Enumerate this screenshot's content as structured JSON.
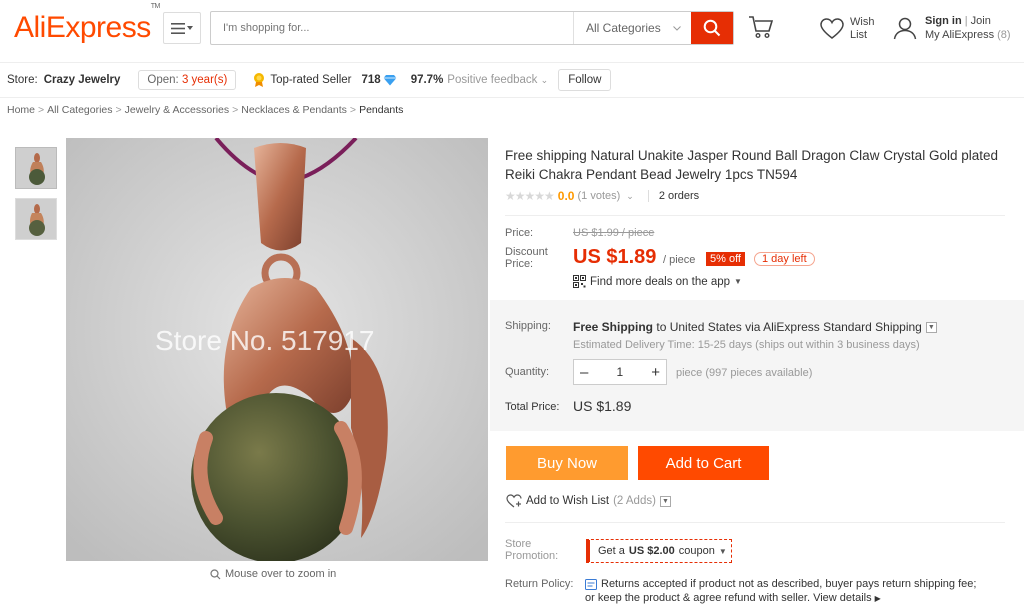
{
  "header": {
    "logo": "AliExpress",
    "logo_tm": "TM",
    "search_placeholder": "I'm shopping for...",
    "category": "All Categories",
    "wish_line1": "Wish",
    "wish_line2": "List",
    "signin": "Sign in",
    "join": "Join",
    "my_account": "My AliExpress",
    "account_count": "(8)"
  },
  "store": {
    "label": "Store:",
    "name": "Crazy Jewelry",
    "open_prefix": "Open:",
    "open_years": "3 year(s)",
    "top_rated": "Top-rated Seller",
    "score": "718",
    "feedback_pct": "97.7%",
    "feedback_label": "Positive feedback",
    "follow": "Follow"
  },
  "breadcrumb": [
    "Home",
    "All Categories",
    "Jewelry & Accessories",
    "Necklaces & Pendants",
    "Pendants"
  ],
  "image": {
    "watermark": "Store No. 517917",
    "zoom_hint": "Mouse over to zoom in"
  },
  "product": {
    "title": "Free shipping Natural Unakite Jasper Round Ball Dragon Claw Crystal Gold plated Reiki Chakra Pendant Bead Jewelry 1pcs TN594",
    "rating": "0.0",
    "votes": "(1 votes)",
    "orders": "2 orders"
  },
  "price": {
    "price_label": "Price:",
    "old_price": "US $1.99 / piece",
    "discount_label_1": "Discount",
    "discount_label_2": "Price:",
    "new_price": "US $1.89",
    "per_piece": "/ piece",
    "off": "5% off",
    "day_left": "1 day left",
    "deals": "Find more deals on the app"
  },
  "shipping": {
    "label": "Shipping:",
    "free": "Free Shipping",
    "to": "to United States via AliExpress Standard Shipping",
    "estimate": "Estimated Delivery Time: 15-25 days (ships out within 3 business days)",
    "qty_label": "Quantity:",
    "qty_value": "1",
    "qty_available": "piece (997 pieces available)",
    "total_label": "Total Price:",
    "total_value": "US $1.89"
  },
  "actions": {
    "buy_now": "Buy Now",
    "add_to_cart": "Add to Cart",
    "wishlist": "Add to Wish List",
    "wishlist_count": "(2 Adds)"
  },
  "promo": {
    "label_1": "Store",
    "label_2": "Promotion:",
    "coupon_prefix": "Get a",
    "coupon_amount": "US $2.00",
    "coupon_suffix": "coupon"
  },
  "return_policy": {
    "label": "Return Policy:",
    "text_1": "Returns accepted if product not as described, buyer pays return shipping fee;",
    "text_2": "or keep the product & agree refund with seller.",
    "view_details": "View details"
  },
  "colors": {
    "brand": "#ff4a00",
    "accent_red": "#e62e04",
    "buy_now": "#ff9b2f"
  }
}
